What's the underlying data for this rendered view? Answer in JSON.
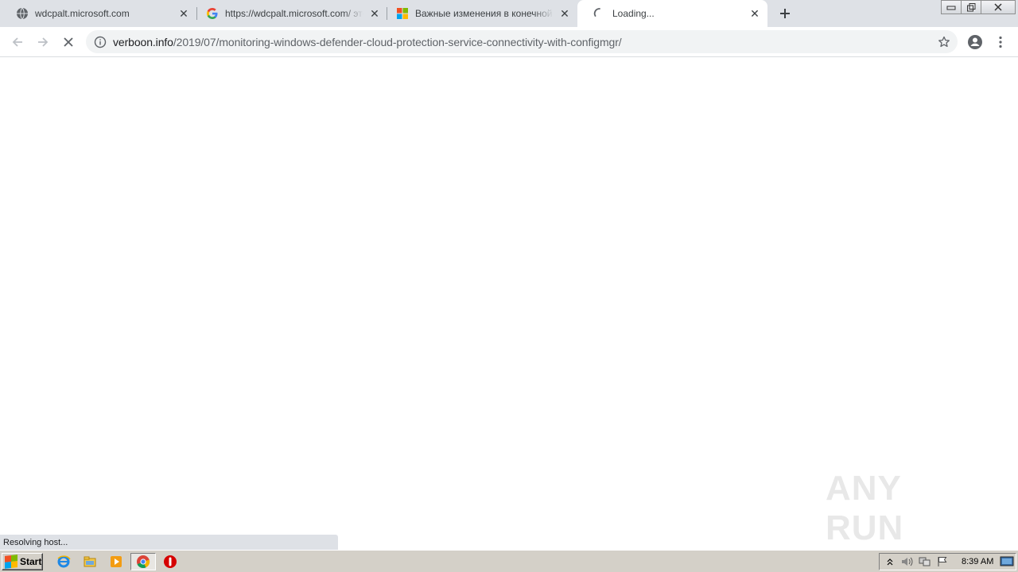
{
  "tabs": [
    {
      "title": "wdcpalt.microsoft.com",
      "favicon": "globe-icon",
      "active": false
    },
    {
      "title": "https://wdcpalt.microsoft.com/ это – По",
      "favicon": "google-g-icon",
      "active": false
    },
    {
      "title": "Важные изменения в конечной точ",
      "favicon": "microsoft-logo-icon",
      "active": false
    },
    {
      "title": "Loading...",
      "favicon": "spinner-icon",
      "active": true
    }
  ],
  "toolbar": {
    "url_host": "verboon.info",
    "url_path": "/2019/07/monitoring-windows-defender-cloud-protection-service-connectivity-with-configmgr/"
  },
  "status_bubble": "Resolving host...",
  "watermark": "ANY RUN",
  "taskbar": {
    "start_label": "Start",
    "clock": "8:39 AM"
  },
  "colors": {
    "tabstrip": "#dee1e6",
    "active_tab": "#ffffff",
    "omnibox": "#f1f3f4",
    "taskbar": "#d4d0c8"
  }
}
